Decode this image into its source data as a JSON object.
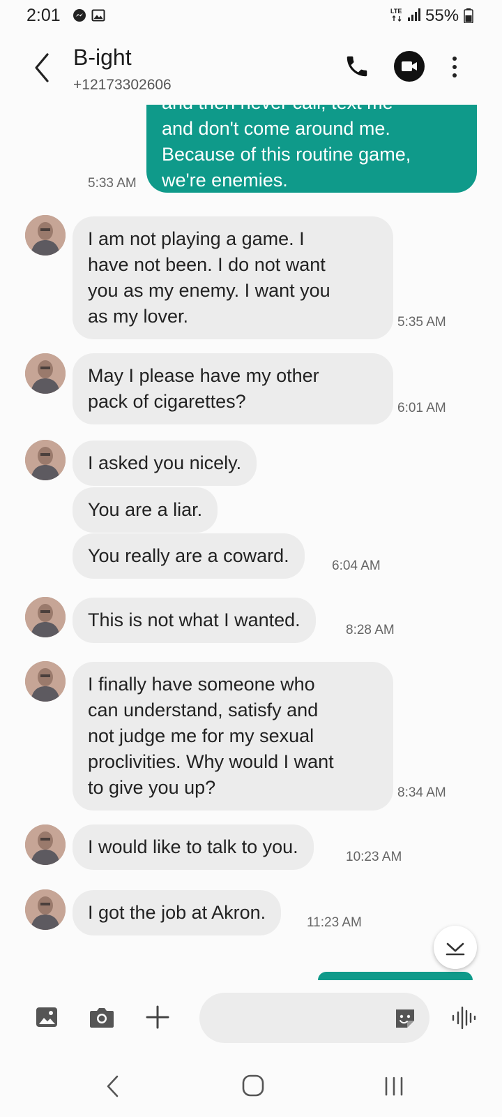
{
  "status_bar": {
    "time": "2:01",
    "battery_text": "55%",
    "icons": [
      "messenger-icon",
      "gallery-notification-icon",
      "lte-icon",
      "signal-icon",
      "battery-icon"
    ]
  },
  "header": {
    "contact_name": "B-ight",
    "contact_number": "+12173302606",
    "icons": [
      "back-arrow-icon",
      "phone-icon",
      "video-call-icon",
      "more-vert-icon"
    ]
  },
  "messages": [
    {
      "direction": "out",
      "lines": [
        "and then never call, text me",
        "and don't come around me.",
        "Because of this routine game,",
        "we're enemies."
      ],
      "time": "5:33 AM"
    },
    {
      "direction": "in",
      "lines": [
        "I am not playing a game.  I",
        "have not been.  I do not want",
        "you as my enemy.  I want you",
        "as my lover."
      ],
      "time": "5:35 AM"
    },
    {
      "direction": "in",
      "lines": [
        "May I please have my other",
        "pack of cigarettes?"
      ],
      "time": "6:01 AM"
    },
    {
      "direction": "in",
      "lines": [
        "I asked you nicely."
      ],
      "time": ""
    },
    {
      "direction": "in",
      "lines": [
        "You are a liar."
      ],
      "time": ""
    },
    {
      "direction": "in",
      "lines": [
        "You really are a coward."
      ],
      "time": "6:04 AM"
    },
    {
      "direction": "in",
      "lines": [
        "This is not what I wanted."
      ],
      "time": "8:28 AM"
    },
    {
      "direction": "in",
      "lines": [
        "I finally have someone who",
        "can understand, satisfy and",
        "not judge me for my sexual",
        "proclivities.  Why would I want",
        "to give you up?"
      ],
      "time": "8:34 AM"
    },
    {
      "direction": "in",
      "lines": [
        "I would like to talk to you."
      ],
      "time": "10:23 AM"
    },
    {
      "direction": "in",
      "lines": [
        "I got the job at Akron."
      ],
      "time": "11:23 AM"
    }
  ],
  "composer": {
    "placeholder": "",
    "icons": [
      "image-icon",
      "camera-icon",
      "plus-icon",
      "sticker-icon",
      "voice-waveform-icon"
    ]
  },
  "nav_bar": {
    "icons": [
      "nav-back-icon",
      "nav-home-icon",
      "nav-recents-icon"
    ]
  },
  "colors": {
    "outgoing_bubble": "#0f9a8a",
    "incoming_bubble": "#ececec",
    "background": "#fbfbfb"
  }
}
